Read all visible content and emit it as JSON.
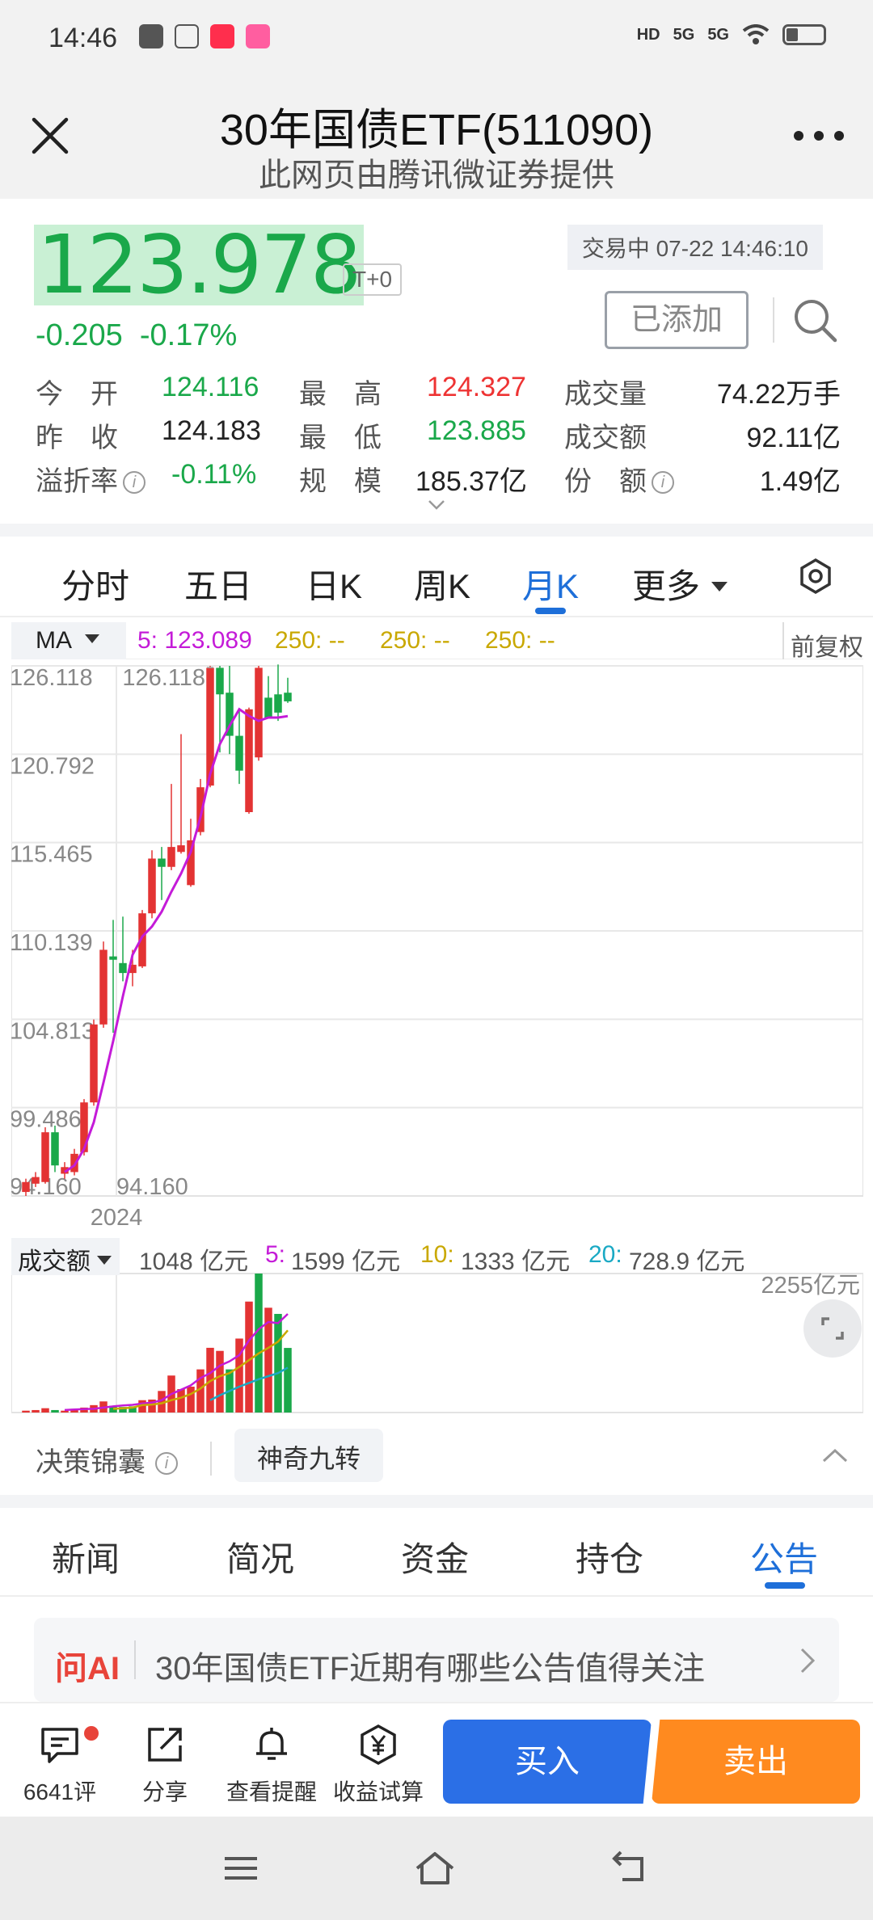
{
  "status_bar": {
    "time": "14:46",
    "icons_left": [
      "scissors-app-icon",
      "alipay-icon",
      "xiaohongshu-icon",
      "lol-app-icon"
    ],
    "icons_right": [
      "hd-icon",
      "signal-5g-icon",
      "signal-5g-icon",
      "wifi-icon",
      "battery-icon"
    ],
    "hd_label": "HD",
    "net1": "5G",
    "net2": "5G"
  },
  "header": {
    "title": "30年国债ETF(511090)",
    "subtitle": "此网页由腾讯微证券提供",
    "close_icon": "close-icon",
    "more_icon": "more-dots-icon"
  },
  "quote": {
    "price": "123.978",
    "t0_label": "T+0",
    "change": "-0.205",
    "change_pct": "-0.17%",
    "trade_status": "交易中 07-22 14:46:10",
    "added_label": "已添加",
    "colors": {
      "down": "#1aa84a",
      "up": "#e33333",
      "price_bg": "#c9f0d4"
    }
  },
  "stats": [
    [
      {
        "label": "今　开",
        "value": "124.116",
        "color": "green"
      },
      {
        "label": "最　高",
        "value": "124.327",
        "color": "red"
      },
      {
        "label": "成交量",
        "value": "74.22万手",
        "color": "black"
      }
    ],
    [
      {
        "label": "昨　收",
        "value": "124.183",
        "color": "black"
      },
      {
        "label": "最　低",
        "value": "123.885",
        "color": "green"
      },
      {
        "label": "成交额",
        "value": "92.11亿",
        "color": "black"
      }
    ],
    [
      {
        "label": "溢折率",
        "value": "-0.11%",
        "color": "green",
        "info": true
      },
      {
        "label": "规　模",
        "value": "185.37亿",
        "color": "black"
      },
      {
        "label": "份　额",
        "value": "1.49亿",
        "color": "black",
        "info": true
      }
    ]
  ],
  "info_glyph": "i",
  "kline_tabs": {
    "items": [
      "分时",
      "五日",
      "日K",
      "周K",
      "月K",
      "更多"
    ],
    "active": "月K"
  },
  "ma_bar": {
    "selector": "MA",
    "legends": [
      {
        "text": "5: 123.089",
        "color": "#c41bd8"
      },
      {
        "text": "250: --",
        "color": "#c9a800"
      },
      {
        "text": "250: --",
        "color": "#c9a800"
      },
      {
        "text": "250: --",
        "color": "#c9a800"
      }
    ],
    "adjust": "前复权"
  },
  "chart_data": [
    {
      "type": "candlestick",
      "title": "",
      "y_ticks": [
        "126.118",
        "120.792",
        "115.465",
        "110.139",
        "104.813",
        "99.486",
        "94.160"
      ],
      "ylim": [
        94.16,
        126.118
      ],
      "x_label": "2024",
      "max_label": "126.118",
      "min_label": "94.160",
      "candles": [
        {
          "o": 94.4,
          "c": 95.0,
          "h": 95.2,
          "l": 94.16
        },
        {
          "o": 94.9,
          "c": 95.3,
          "h": 95.6,
          "l": 94.7
        },
        {
          "o": 95.0,
          "c": 98.0,
          "h": 98.3,
          "l": 94.9
        },
        {
          "o": 98.0,
          "c": 96.0,
          "h": 98.4,
          "l": 95.6
        },
        {
          "o": 95.5,
          "c": 95.9,
          "h": 96.2,
          "l": 95.2
        },
        {
          "o": 95.6,
          "c": 96.7,
          "h": 97.0,
          "l": 95.4
        },
        {
          "o": 96.8,
          "c": 99.8,
          "h": 100.0,
          "l": 96.6
        },
        {
          "o": 99.8,
          "c": 104.5,
          "h": 104.8,
          "l": 99.6
        },
        {
          "o": 104.5,
          "c": 109.0,
          "h": 109.5,
          "l": 104.3
        },
        {
          "o": 108.6,
          "c": 108.4,
          "h": 110.8,
          "l": 104.0
        },
        {
          "o": 108.2,
          "c": 107.6,
          "h": 111.0,
          "l": 107.1
        },
        {
          "o": 107.6,
          "c": 108.1,
          "h": 109.0,
          "l": 106.8
        },
        {
          "o": 108.0,
          "c": 111.2,
          "h": 111.4,
          "l": 107.9
        },
        {
          "o": 111.2,
          "c": 114.5,
          "h": 115.0,
          "l": 110.9
        },
        {
          "o": 114.5,
          "c": 114.0,
          "h": 115.2,
          "l": 112.0
        },
        {
          "o": 114.0,
          "c": 115.2,
          "h": 119.0,
          "l": 113.8
        },
        {
          "o": 114.9,
          "c": 115.3,
          "h": 122.0,
          "l": 114.8
        },
        {
          "o": 112.9,
          "c": 115.6,
          "h": 116.9,
          "l": 112.8
        },
        {
          "o": 116.1,
          "c": 118.8,
          "h": 119.3,
          "l": 115.9
        },
        {
          "o": 118.9,
          "c": 126.0,
          "h": 126.118,
          "l": 118.8
        },
        {
          "o": 126.0,
          "c": 124.4,
          "h": 126.118,
          "l": 120.9
        },
        {
          "o": 124.5,
          "c": 121.9,
          "h": 126.118,
          "l": 120.8
        },
        {
          "o": 121.9,
          "c": 119.8,
          "h": 123.4,
          "l": 119.0
        },
        {
          "o": 117.3,
          "c": 123.5,
          "h": 123.6,
          "l": 117.2
        },
        {
          "o": 120.6,
          "c": 126.0,
          "h": 126.118,
          "l": 120.4
        },
        {
          "o": 124.2,
          "c": 123.0,
          "h": 125.5,
          "l": 123.0
        },
        {
          "o": 124.4,
          "c": 123.3,
          "h": 126.2,
          "l": 122.8
        },
        {
          "o": 124.5,
          "c": 123.978,
          "h": 125.4,
          "l": 123.885
        }
      ],
      "series": [
        {
          "name": "MA5",
          "color": "#c41bd8",
          "values": [
            null,
            null,
            null,
            null,
            95.6,
            96.0,
            97.0,
            98.6,
            101.0,
            103.5,
            106.2,
            108.7,
            109.8,
            110.4,
            111.3,
            112.5,
            113.6,
            114.9,
            117.0,
            119.6,
            121.4,
            122.5,
            123.5,
            123.1,
            122.8,
            123.0,
            123.0,
            123.089
          ]
        }
      ]
    },
    {
      "type": "bar",
      "title": "",
      "unit": "亿元",
      "max_label": "2255亿元",
      "ylim": [
        0,
        2255
      ],
      "values": [
        30,
        40,
        70,
        40,
        30,
        60,
        80,
        120,
        180,
        110,
        90,
        100,
        200,
        210,
        350,
        600,
        380,
        420,
        700,
        1050,
        1000,
        700,
        1200,
        1800,
        2255,
        1700,
        1600,
        1048
      ],
      "colors": [
        "r",
        "r",
        "r",
        "g",
        "r",
        "r",
        "r",
        "r",
        "r",
        "g",
        "g",
        "g",
        "r",
        "r",
        "r",
        "r",
        "r",
        "r",
        "r",
        "r",
        "r",
        "g",
        "r",
        "r",
        "g",
        "r",
        "g",
        "g"
      ],
      "series": [
        {
          "name": "5",
          "color": "#c41bd8",
          "values": [
            null,
            null,
            null,
            null,
            40,
            50,
            55,
            60,
            80,
            100,
            115,
            125,
            145,
            160,
            200,
            300,
            370,
            440,
            560,
            640,
            760,
            830,
            930,
            1170,
            1350,
            1470,
            1450,
            1599
          ]
        },
        {
          "name": "10",
          "color": "#c9a800",
          "values": [
            null,
            null,
            null,
            null,
            null,
            null,
            null,
            null,
            null,
            60,
            70,
            80,
            120,
            130,
            150,
            200,
            240,
            300,
            390,
            510,
            590,
            640,
            740,
            850,
            960,
            1050,
            1150,
            1333
          ]
        },
        {
          "name": "20",
          "color": "#1aa9c4",
          "values": [
            null,
            null,
            null,
            null,
            null,
            null,
            null,
            null,
            null,
            null,
            null,
            null,
            null,
            null,
            null,
            null,
            null,
            null,
            null,
            200,
            280,
            350,
            420,
            480,
            540,
            590,
            640,
            728.9
          ]
        }
      ]
    }
  ],
  "volume_bar": {
    "selector": "成交额",
    "current": "1048 亿元",
    "ma5_label": "5:",
    "ma5_value": "1599 亿元",
    "ma10_label": "10:",
    "ma10_value": "1333 亿元",
    "ma20_label": "20:",
    "ma20_value": "728.9 亿元",
    "expand_icon": "expand-icon"
  },
  "decision": {
    "label": "决策锦囊",
    "chip": "神奇九转",
    "collapse_icon": "chevron-up-icon"
  },
  "news_tabs": {
    "items": [
      "新闻",
      "简况",
      "资金",
      "持仓",
      "公告"
    ],
    "active": "公告"
  },
  "ai": {
    "label": "问AI",
    "text": "30年国债ETF近期有哪些公告值得关注"
  },
  "bottom_bar": {
    "items": [
      {
        "label": "6641评",
        "icon": "comment-icon"
      },
      {
        "label": "分享",
        "icon": "share-icon"
      },
      {
        "label": "查看提醒",
        "icon": "alarm-icon"
      },
      {
        "label": "收益试算",
        "icon": "yen-calculator-icon"
      }
    ],
    "buy": "买入",
    "sell": "卖出"
  },
  "nav": {
    "icons": [
      "menu-icon",
      "home-icon",
      "back-icon"
    ]
  }
}
